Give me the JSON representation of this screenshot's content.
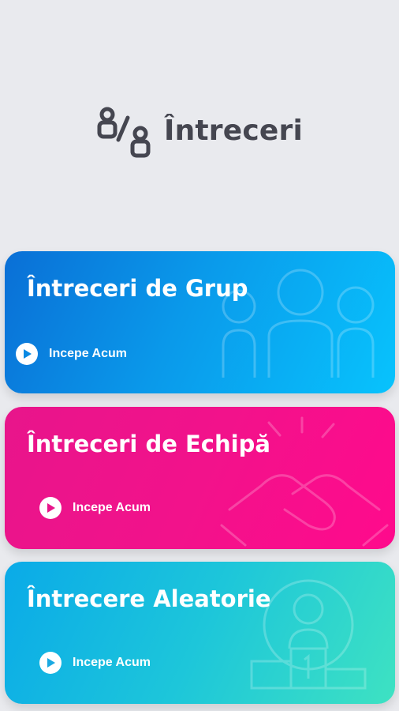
{
  "header": {
    "title": "Întreceri",
    "icon": "versus-icon"
  },
  "cards": [
    {
      "title": "Întreceri de Grup",
      "action": "Incepe Acum",
      "icon": "group-people-icon"
    },
    {
      "title": "Întreceri de Echipă",
      "action": "Incepe Acum",
      "icon": "handshake-icon"
    },
    {
      "title": "Întrecere Aleatorie",
      "action": "Incepe Acum",
      "icon": "winner-podium-icon"
    }
  ],
  "colors": {
    "background": "#e9eaee",
    "title": "#454650",
    "group": "#0a99ea",
    "team": "#f2128b",
    "random": "#1dc6da"
  }
}
